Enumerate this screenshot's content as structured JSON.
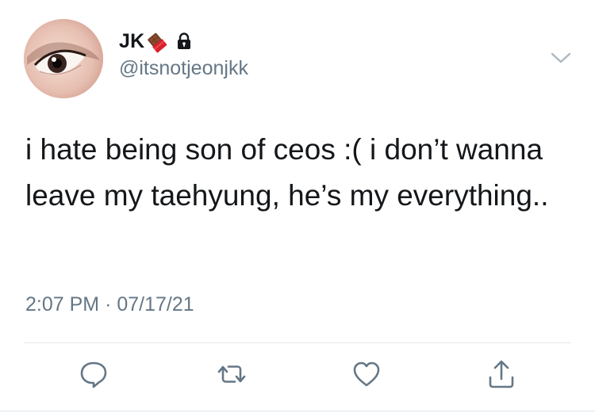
{
  "tweet": {
    "display_name": "JK",
    "handle": "@itsnotjeonjkk",
    "name_emoji": "chocolate-bar-emoji",
    "name_badge": "lock-icon",
    "text": "i hate being son of ceos :( i don’t wanna leave my taehyung, he’s my everything..",
    "time": "2:07 PM",
    "separator": "·",
    "date": "07/17/21"
  },
  "actions": [
    "reply-icon",
    "retweet-icon",
    "like-icon",
    "share-icon"
  ],
  "colors": {
    "text": "#14171a",
    "secondary": "#657786",
    "divider": "#e1e8ed"
  }
}
